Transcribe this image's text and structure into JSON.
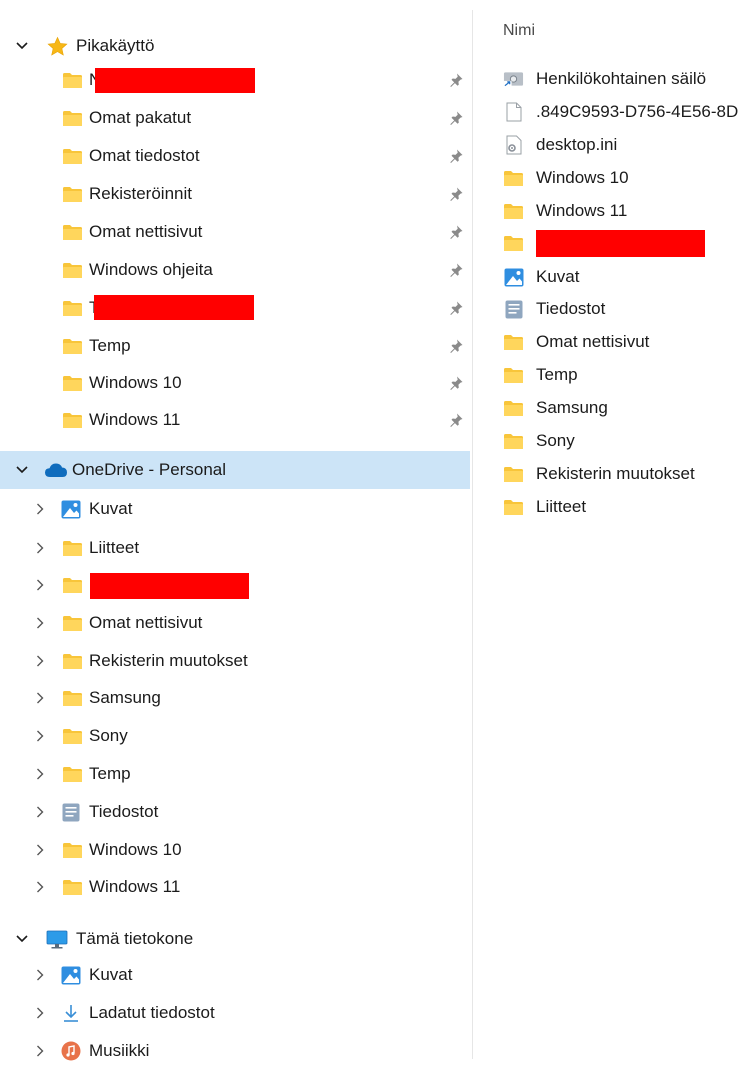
{
  "nav": {
    "quick_access": {
      "label": "Pikakäyttö",
      "items": [
        {
          "label": "N",
          "redacted": true
        },
        {
          "label": "Omat pakatut"
        },
        {
          "label": "Omat tiedostot"
        },
        {
          "label": "Rekisteröinnit"
        },
        {
          "label": "Omat nettisivut"
        },
        {
          "label": "Windows ohjeita"
        },
        {
          "label": "T",
          "redacted": true
        },
        {
          "label": "Temp"
        },
        {
          "label": "Windows 10"
        },
        {
          "label": "Windows 11"
        }
      ]
    },
    "onedrive": {
      "label": "OneDrive - Personal",
      "items": [
        {
          "label": "Kuvat",
          "icon": "pictures-icon"
        },
        {
          "label": "Liitteet",
          "icon": "folder-icon"
        },
        {
          "label": "",
          "icon": "folder-icon",
          "redacted": true
        },
        {
          "label": "Omat nettisivut",
          "icon": "folder-icon"
        },
        {
          "label": "Rekisterin muutokset",
          "icon": "folder-icon"
        },
        {
          "label": "Samsung",
          "icon": "folder-icon"
        },
        {
          "label": "Sony",
          "icon": "folder-icon"
        },
        {
          "label": "Temp",
          "icon": "folder-icon"
        },
        {
          "label": "Tiedostot",
          "icon": "documents-icon"
        },
        {
          "label": "Windows 10",
          "icon": "folder-icon"
        },
        {
          "label": "Windows 11",
          "icon": "folder-icon"
        }
      ]
    },
    "this_pc": {
      "label": "Tämä tietokone",
      "items": [
        {
          "label": "Kuvat",
          "icon": "pictures-icon"
        },
        {
          "label": "Ladatut tiedostot",
          "icon": "downloads-icon"
        },
        {
          "label": "Musiikki",
          "icon": "music-icon"
        }
      ]
    }
  },
  "content": {
    "column_header": "Nimi",
    "files": [
      {
        "label": "Henkilökohtainen säilö",
        "icon": "vault-icon"
      },
      {
        "label": ".849C9593-D756-4E56-8D",
        "icon": "file-icon"
      },
      {
        "label": "desktop.ini",
        "icon": "settings-file-icon"
      },
      {
        "label": "Windows 10",
        "icon": "folder-icon"
      },
      {
        "label": "Windows 11",
        "icon": "folder-icon"
      },
      {
        "label": "",
        "icon": "folder-icon",
        "redacted": true
      },
      {
        "label": "Kuvat",
        "icon": "pictures-icon"
      },
      {
        "label": "Tiedostot",
        "icon": "documents-icon"
      },
      {
        "label": "Omat nettisivut",
        "icon": "folder-icon"
      },
      {
        "label": "Temp",
        "icon": "folder-icon"
      },
      {
        "label": "Samsung",
        "icon": "folder-icon"
      },
      {
        "label": "Sony",
        "icon": "folder-icon"
      },
      {
        "label": "Rekisterin muutokset",
        "icon": "folder-icon"
      },
      {
        "label": "Liitteet",
        "icon": "folder-icon"
      }
    ]
  }
}
